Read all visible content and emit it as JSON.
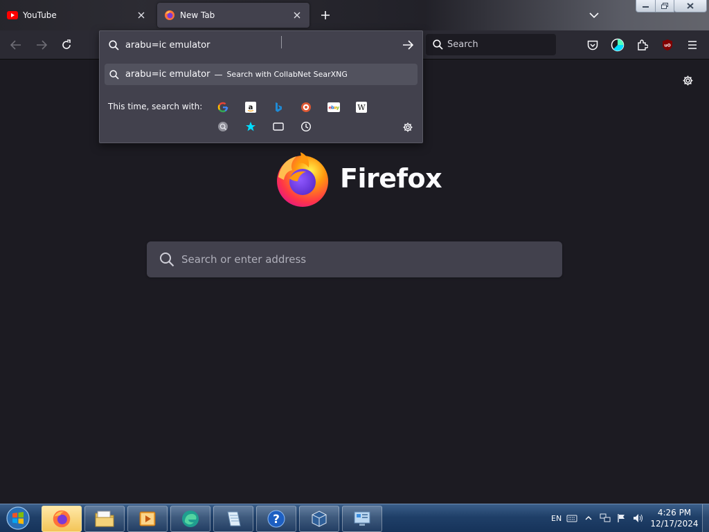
{
  "tabs": [
    {
      "title": "YouTube",
      "favicon": "youtube-icon",
      "active": false
    },
    {
      "title": "New Tab",
      "favicon": "firefox-icon",
      "active": true
    }
  ],
  "urlbar": {
    "value": "arabu=ic emulator",
    "suggestion_query": "arabu=ic emulator",
    "suggestion_separator": "—",
    "suggestion_action": "Search with CollabNet SearXNG",
    "oneoff_label": "This time, search with:",
    "engines": [
      "google",
      "amazon",
      "bing",
      "duckduckgo",
      "ebay",
      "wikipedia",
      "searxng",
      "bookmarks",
      "tabs",
      "history"
    ]
  },
  "toolbar": {
    "search_placeholder": "Search"
  },
  "newtab": {
    "brand": "Firefox",
    "search_placeholder": "Search or enter address"
  },
  "taskbar": {
    "language": "EN",
    "time": "4:26 PM",
    "date": "12/17/2024"
  },
  "colors": {
    "background": "#1c1b22",
    "toolbar": "#2b2a33",
    "panel": "#42414d",
    "accent_firefox": "#ff7139"
  }
}
